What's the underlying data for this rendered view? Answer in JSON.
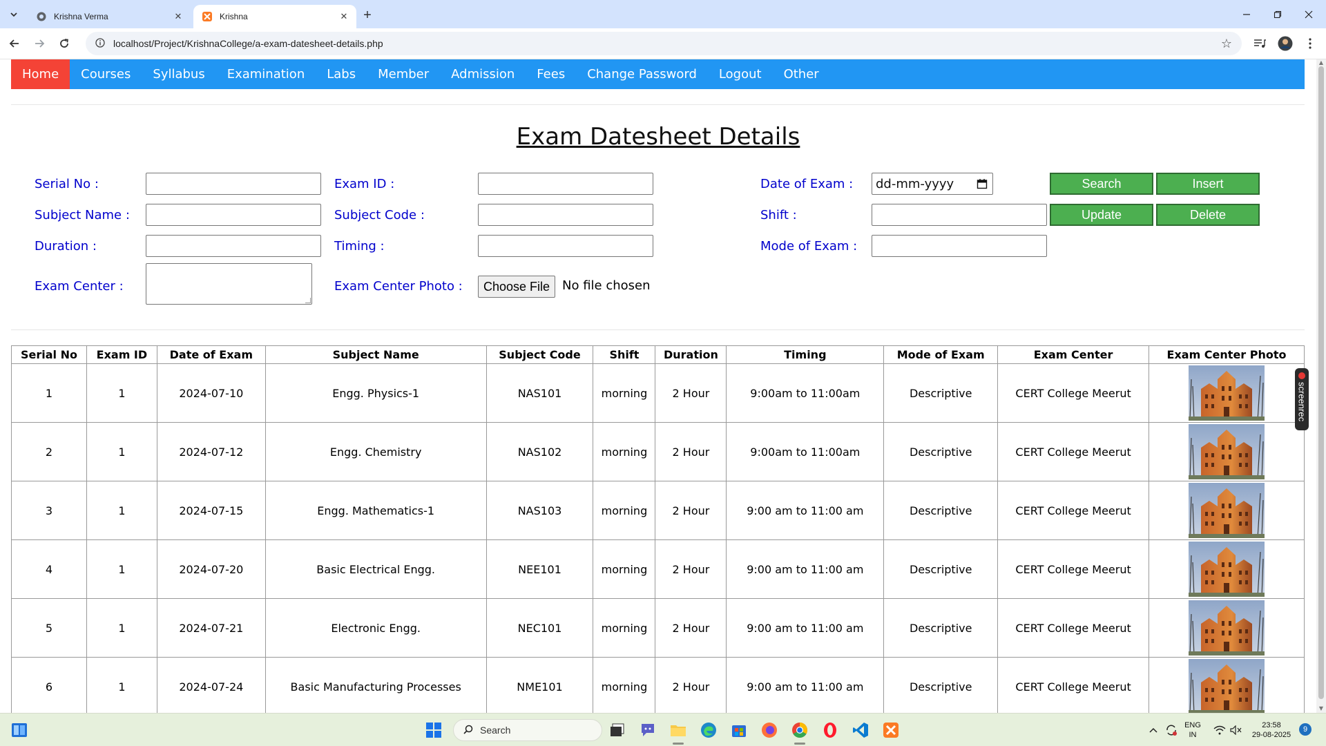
{
  "browser": {
    "tabs": [
      {
        "title": "Krishna Verma",
        "active": false
      },
      {
        "title": "Krishna",
        "active": true
      }
    ],
    "url": "localhost/Project/KrishnaCollege/a-exam-datesheet-details.php"
  },
  "menu": [
    "Home",
    "Courses",
    "Syllabus",
    "Examination",
    "Labs",
    "Member",
    "Admission",
    "Fees",
    "Change Password",
    "Logout",
    "Other"
  ],
  "page_title": "Exam Datesheet Details",
  "form": {
    "serial_no": "Serial No :",
    "exam_id": "Exam ID :",
    "date_of_exam": "Date of Exam :",
    "date_placeholder": "dd-mm-yyyy",
    "subject_name": "Subject Name :",
    "subject_code": "Subject Code :",
    "shift": "Shift :",
    "duration": "Duration :",
    "timing": "Timing :",
    "mode_of_exam": "Mode of Exam :",
    "exam_center": "Exam Center :",
    "exam_center_photo": "Exam Center Photo :",
    "choose_file": "Choose File",
    "no_file": "No file chosen",
    "search_btn": "Search",
    "insert_btn": "Insert",
    "update_btn": "Update",
    "delete_btn": "Delete"
  },
  "table": {
    "headers": [
      "Serial No",
      "Exam ID",
      "Date of Exam",
      "Subject Name",
      "Subject Code",
      "Shift",
      "Duration",
      "Timing",
      "Mode of Exam",
      "Exam Center",
      "Exam Center Photo"
    ],
    "rows": [
      [
        "1",
        "1",
        "2024-07-10",
        "Engg. Physics-1",
        "NAS101",
        "morning",
        "2 Hour",
        "9:00am to 11:00am",
        "Descriptive",
        "CERT College Meerut"
      ],
      [
        "2",
        "1",
        "2024-07-12",
        "Engg. Chemistry",
        "NAS102",
        "morning",
        "2 Hour",
        "9:00am to 11:00am",
        "Descriptive",
        "CERT College Meerut"
      ],
      [
        "3",
        "1",
        "2024-07-15",
        "Engg. Mathematics-1",
        "NAS103",
        "morning",
        "2 Hour",
        "9:00 am to 11:00 am",
        "Descriptive",
        "CERT College Meerut"
      ],
      [
        "4",
        "1",
        "2024-07-20",
        "Basic Electrical Engg.",
        "NEE101",
        "morning",
        "2 Hour",
        "9:00 am to 11:00 am",
        "Descriptive",
        "CERT College Meerut"
      ],
      [
        "5",
        "1",
        "2024-07-21",
        "Electronic Engg.",
        "NEC101",
        "morning",
        "2 Hour",
        "9:00 am to 11:00 am",
        "Descriptive",
        "CERT College Meerut"
      ],
      [
        "6",
        "1",
        "2024-07-24",
        "Basic Manufacturing Processes",
        "NME101",
        "morning",
        "2 Hour",
        "9:00 am to 11:00 am",
        "Descriptive",
        "CERT College Meerut"
      ]
    ]
  },
  "screenrec_label": "screenrec",
  "taskbar": {
    "search_placeholder": "Search",
    "lang_line1": "ENG",
    "lang_line2": "IN",
    "time": "23:58",
    "date": "29-08-2025",
    "notification_count": "9"
  },
  "colors": {
    "menu_bg": "#2196f3",
    "menu_active": "#f44336",
    "label": "#0000cc",
    "button": "#4caf50"
  }
}
